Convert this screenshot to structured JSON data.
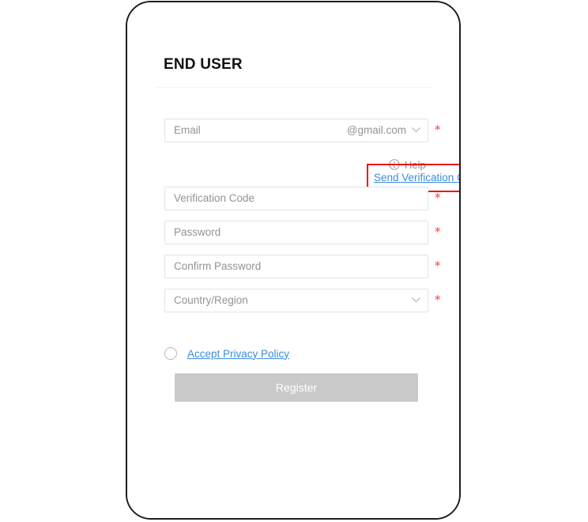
{
  "screen": {
    "title": "END USER"
  },
  "form": {
    "email": {
      "placeholder": "Email",
      "domain_suffix": "@gmail.com",
      "required_marker": "*"
    },
    "help": {
      "label": "Help",
      "icon": "info-circle-icon"
    },
    "send_verification_code": {
      "label": "Send Verification Code",
      "annotation_color": "#ee1111"
    },
    "verification_code": {
      "placeholder": "Verification Code",
      "required_marker": "*"
    },
    "password": {
      "placeholder": "Password",
      "required_marker": "*"
    },
    "confirm_password": {
      "placeholder": "Confirm Password",
      "required_marker": "*"
    },
    "country_region": {
      "placeholder": "Country/Region",
      "required_marker": "*"
    },
    "privacy": {
      "label": "Accept Privacy Policy",
      "checked": false
    },
    "submit": {
      "label": "Register",
      "enabled": false
    }
  },
  "colors": {
    "link": "#3a8ddd",
    "required": "#ff3a3a",
    "annotation": "#ee1111",
    "button_disabled": "#cacaca",
    "placeholder": "#939399",
    "frame": "#1d1d1f"
  }
}
